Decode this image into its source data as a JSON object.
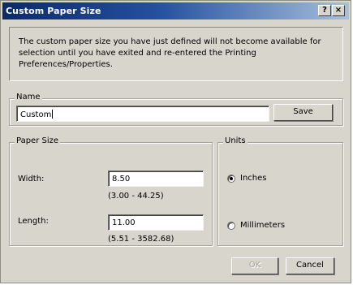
{
  "window": {
    "title": "Custom Paper Size",
    "help_glyph": "?",
    "close_glyph": "×"
  },
  "info": {
    "message": "The custom paper size you have just defined will not become available for selection until you have exited and re-entered the Printing Preferences/Properties."
  },
  "name_group": {
    "legend": "Name",
    "value": "Custom",
    "save_label": "Save"
  },
  "paper_size": {
    "legend": "Paper Size",
    "width_label": "Width:",
    "width_value": "8.50",
    "width_range": "(3.00 - 44.25)",
    "length_label": "Length:",
    "length_value": "11.00",
    "length_range": "(5.51 - 3582.68)"
  },
  "units": {
    "legend": "Units",
    "options": [
      {
        "label": "Inches",
        "selected": true
      },
      {
        "label": "Millimeters",
        "selected": false
      }
    ]
  },
  "buttons": {
    "ok_label": "OK",
    "cancel_label": "Cancel"
  }
}
